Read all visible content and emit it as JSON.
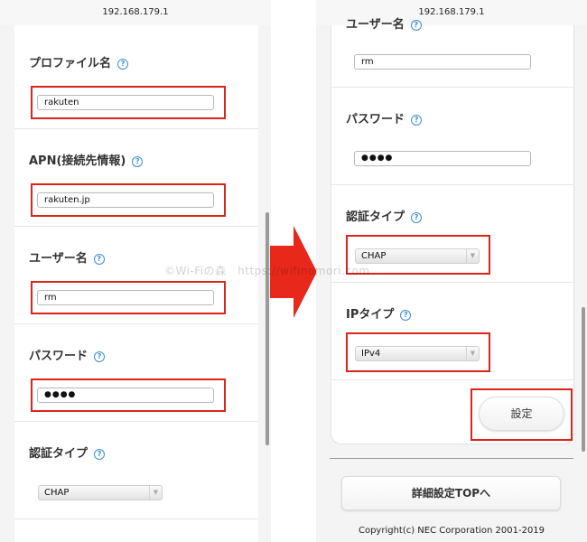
{
  "colors": {
    "highlight": "#d9251b",
    "arrow": "#e8281b",
    "help_icon": "#3b8fd6"
  },
  "left": {
    "url": "192.168.179.1",
    "profile_name": {
      "label": "プロファイル名",
      "value": "rakuten"
    },
    "apn": {
      "label": "APN(接続先情報)",
      "value": "rakuten.jp"
    },
    "username": {
      "label": "ユーザー名",
      "value": "rm"
    },
    "password": {
      "label": "パスワード",
      "value": "●●●●"
    },
    "auth_type": {
      "label": "認証タイプ",
      "value": "CHAP"
    }
  },
  "right": {
    "url": "192.168.179.1",
    "username": {
      "label": "ユーザー名",
      "value": "rm"
    },
    "password": {
      "label": "パスワード",
      "value": "●●●●"
    },
    "auth_type": {
      "label": "認証タイプ",
      "value": "CHAP"
    },
    "ip_type": {
      "label": "IPタイプ",
      "value": "IPv4"
    },
    "set_button": "設定",
    "top_button": "詳細設定TOPへ",
    "copyright": "Copyright(c) NEC Corporation 2001-2019"
  },
  "help_glyph": "?",
  "dropdown_glyph": "▼",
  "watermark": "©Wi-Fiの森　https://wifinomori.com",
  "arrow_icon": "right-arrow-icon"
}
